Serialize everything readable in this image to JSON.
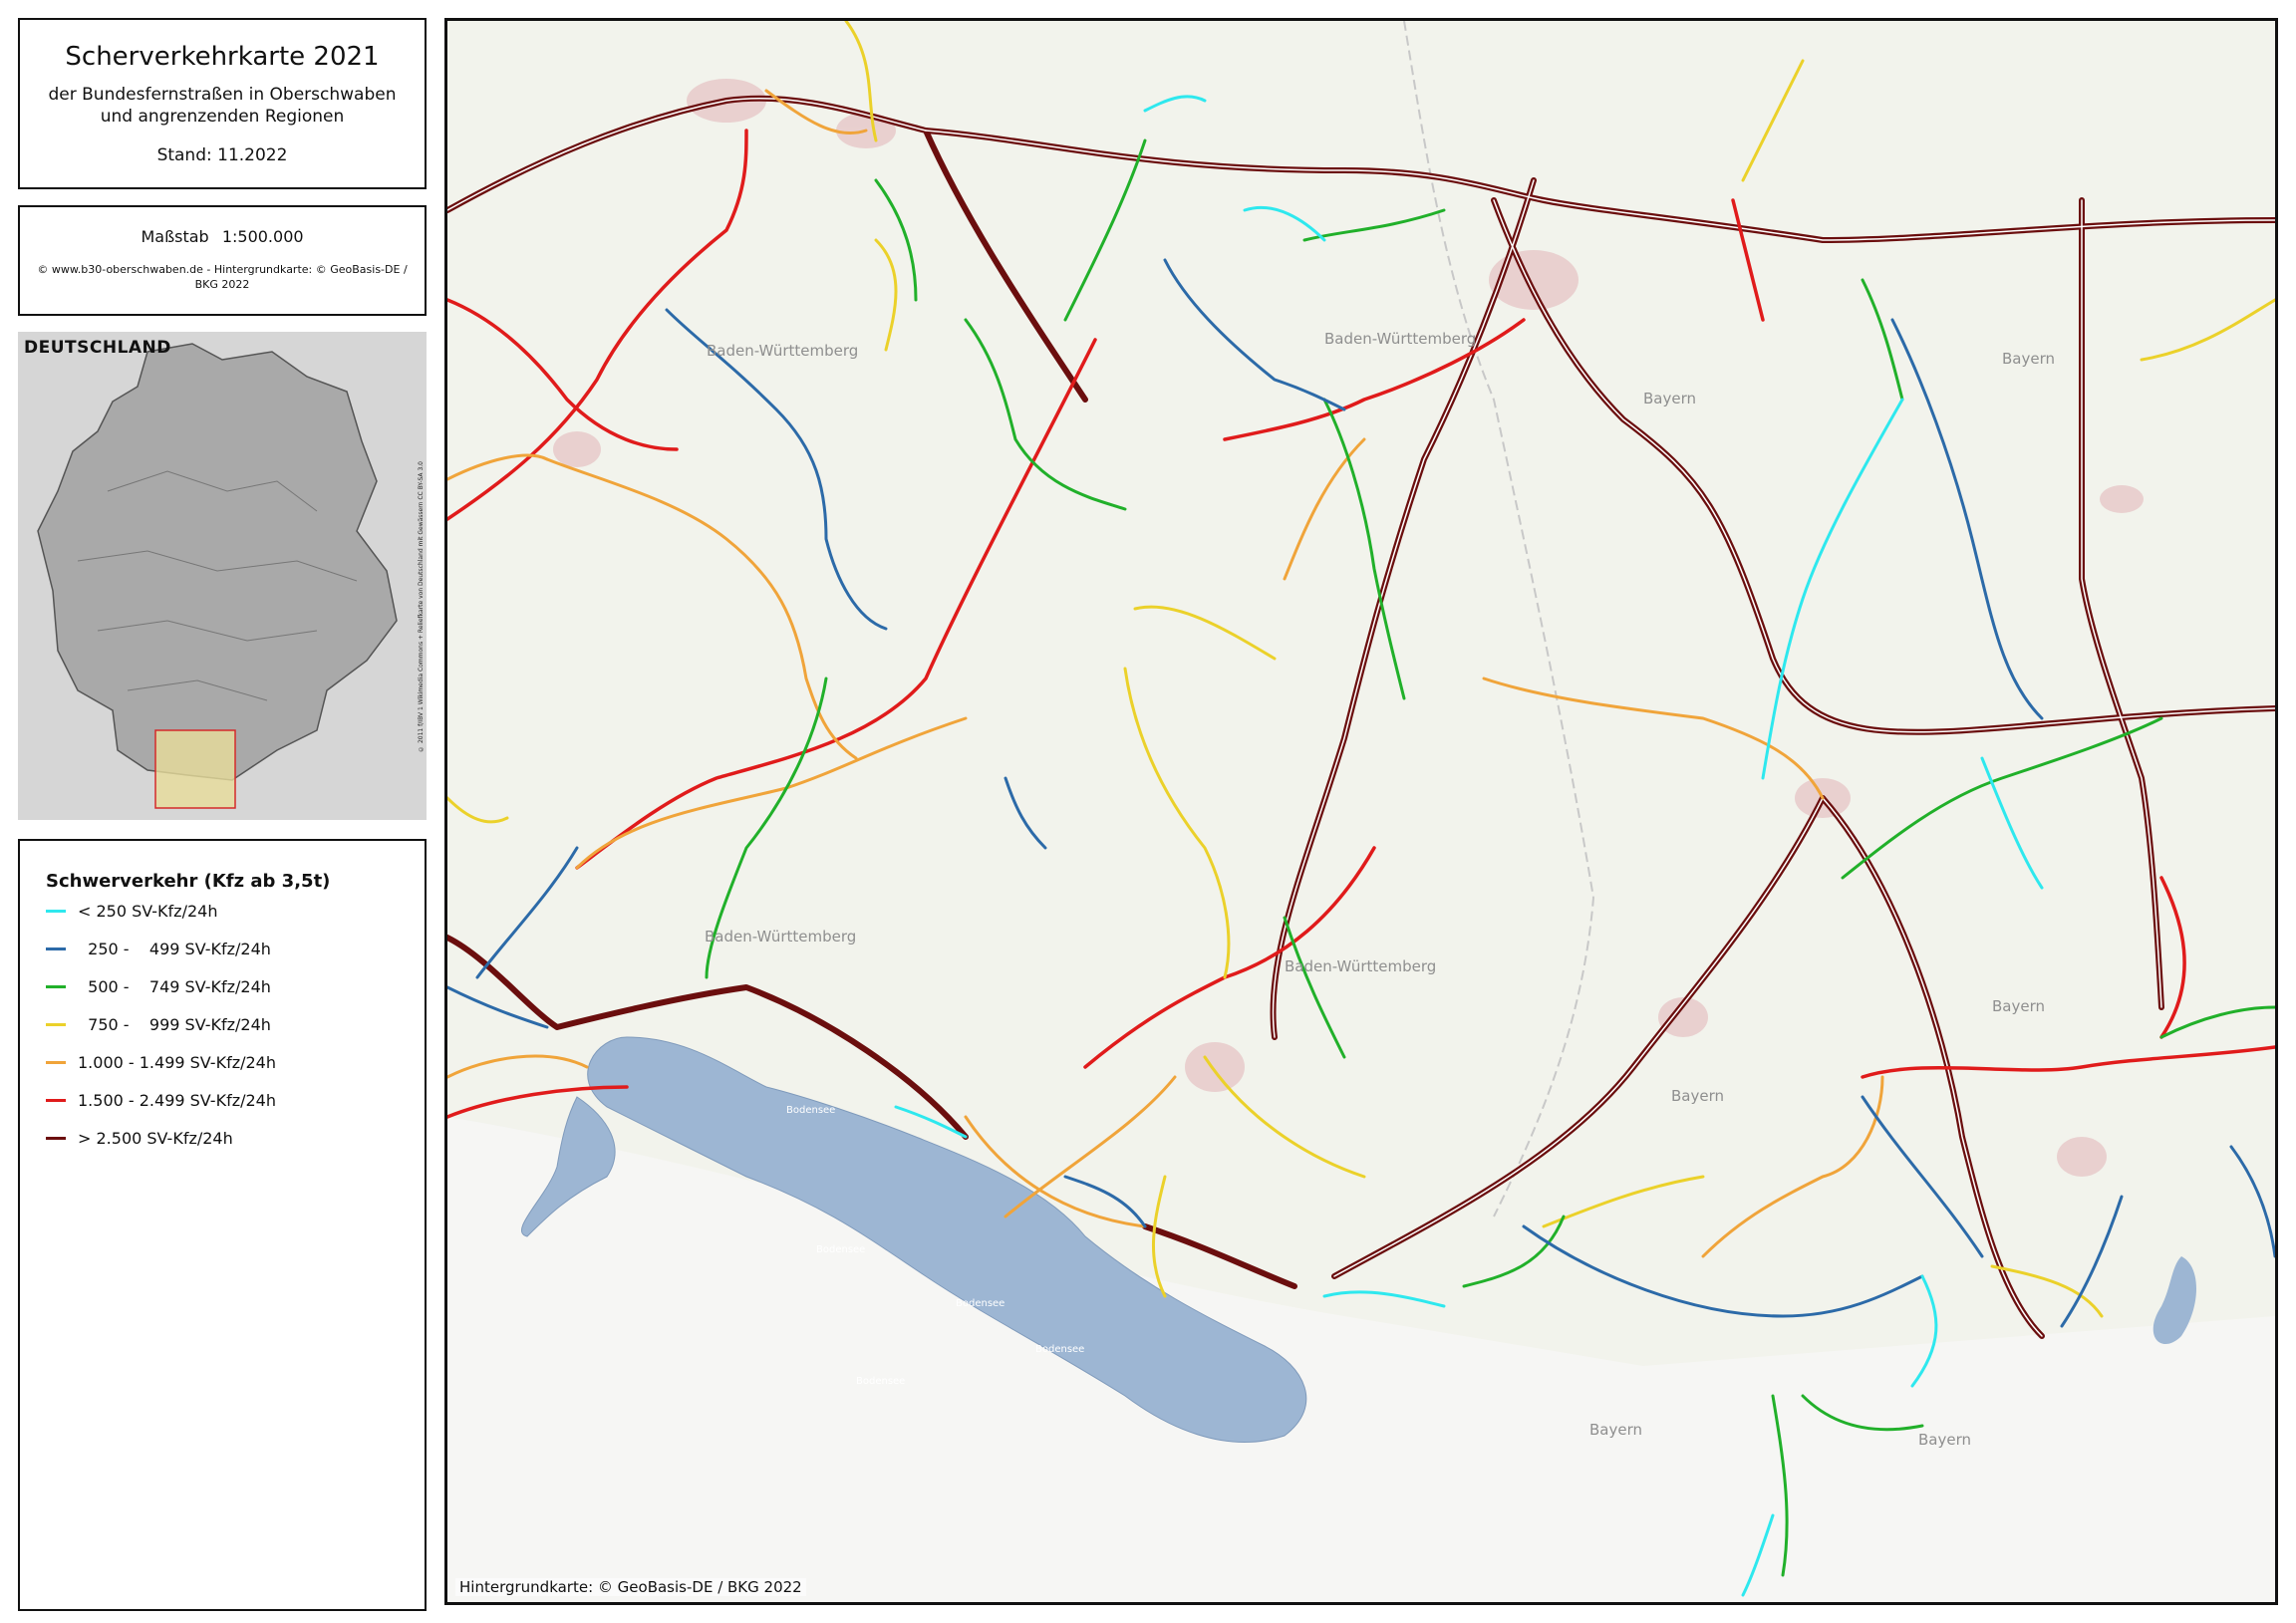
{
  "title": {
    "main": "Scherverkehrkarte 2021",
    "subtitle_line1": "der Bundesfernstraßen in Oberschwaben",
    "subtitle_line2": "und angrenzenden Regionen",
    "stand": "Stand: 11.2022"
  },
  "scale": {
    "label": "Maßstab",
    "value": "1:500.000",
    "credit": "© www.b30-oberschwaben.de - Hintergrundkarte: © GeoBasis-DE / BKG 2022"
  },
  "inset": {
    "label": "DEUTSCHLAND",
    "credit": "© 2011 f/IBV 1 Wikimedia Commons + Reliefkarte von Deutschland mit Gewässern CC BY-SA 3.0"
  },
  "legend": {
    "title": "Schwerverkehr (Kfz ab 3,5t)",
    "items": [
      {
        "label": "< 250 SV-Kfz/24h",
        "color": "#2ee8ee"
      },
      {
        "label": "  250 -    499 SV-Kfz/24h",
        "color": "#2c6aa8"
      },
      {
        "label": "  500 -    749 SV-Kfz/24h",
        "color": "#21b02a"
      },
      {
        "label": "  750 -    999 SV-Kfz/24h",
        "color": "#ebd12a"
      },
      {
        "label": "1.000 - 1.499 SV-Kfz/24h",
        "color": "#f0a43a"
      },
      {
        "label": "1.500 - 2.499 SV-Kfz/24h",
        "color": "#e01b1b"
      },
      {
        "label": "> 2.500 SV-Kfz/24h",
        "color": "#6b0e0e"
      }
    ]
  },
  "map": {
    "credit": "Hintergrundkarte: © GeoBasis-DE / BKG 2022",
    "regions": [
      "Baden-Württemberg",
      "Baden-Württemberg",
      "Baden-Württemberg",
      "Baden-Württemberg",
      "Bayern",
      "Bayern",
      "Bayern",
      "Bayern",
      "Bayern",
      "Bayern"
    ],
    "lake_labels": [
      "Bodensee",
      "Bodensee",
      "Bodensee",
      "Bodensee",
      "Bodensee"
    ],
    "lake_color": "#9db6d3"
  }
}
